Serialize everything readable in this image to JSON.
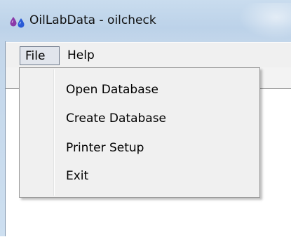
{
  "window": {
    "title": "OilLabData - oilcheck",
    "icon": "oil-drops-icon"
  },
  "menu_bar": {
    "items": [
      {
        "label": "File"
      },
      {
        "label": "Help"
      }
    ]
  },
  "file_menu": {
    "items": [
      {
        "label": "Open Database"
      },
      {
        "label": "Create Database"
      },
      {
        "label": "Printer Setup"
      },
      {
        "label": "Exit"
      }
    ]
  },
  "colors": {
    "icon_drop_left": "#8b3aa8",
    "icon_drop_right": "#2a5bd7",
    "menu_active_bg": "#e1e5ec",
    "menu_active_border": "#6f7b8c"
  }
}
